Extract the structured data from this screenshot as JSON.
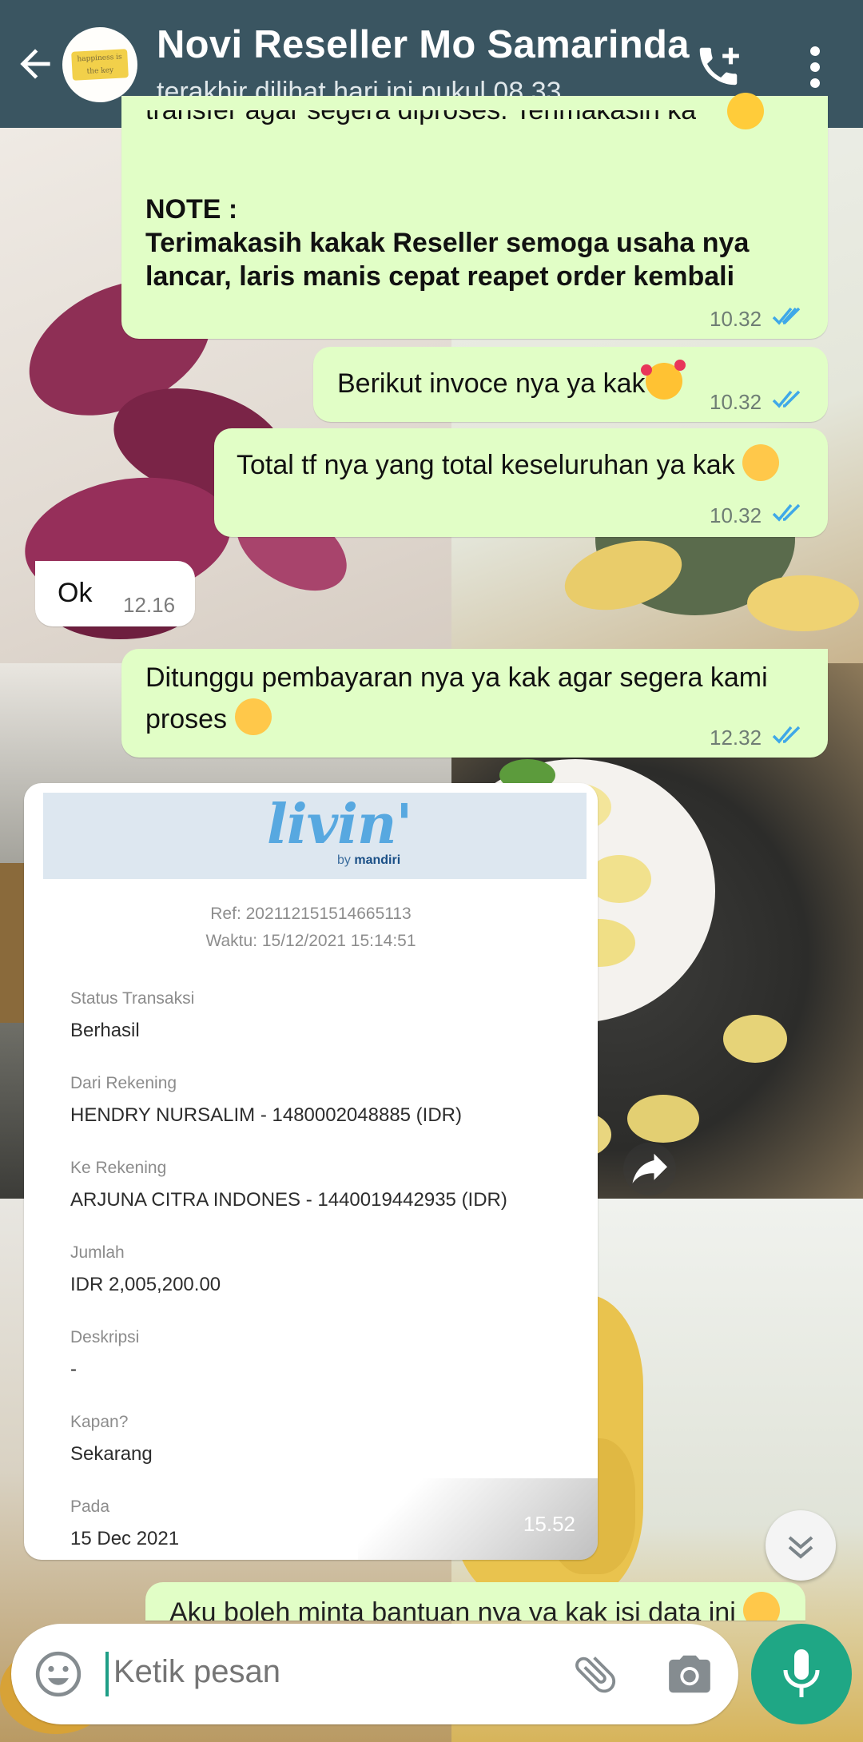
{
  "header": {
    "title": "Novi Reseller Mo Samarinda",
    "status": "terakhir dilihat hari ini pukul 08.33",
    "avatar_text": "happiness is the key"
  },
  "messages": [
    {
      "direction": "outgoing",
      "partial_line": "transfer agar segera diproses. Terimakasih ka",
      "note_label": "NOTE :",
      "note_lines": [
        "Terimakasih kakak Reseller semoga usaha nya",
        "lancar, laris manis cepat reapet order kembali"
      ],
      "time": "10.32"
    },
    {
      "direction": "outgoing",
      "text": "Berikut invoce nya ya kak",
      "emoji": "smiling-face-with-hearts",
      "time": "10.32"
    },
    {
      "direction": "outgoing",
      "text": "Total tf nya yang total keseluruhan ya kak",
      "emoji": "smiling-face",
      "time": "10.32"
    },
    {
      "direction": "incoming",
      "text": "Ok",
      "time": "12.16"
    },
    {
      "direction": "outgoing",
      "lines": [
        "Ditunggu pembayaran nya ya kak agar segera kami",
        "proses"
      ],
      "emoji": "smiling-face",
      "time": "12.32"
    },
    {
      "direction": "outgoing",
      "partial_line": "Aku boleh minta bantuan nya ya kak isi data ini",
      "emoji": "smiling-face"
    }
  ],
  "receipt": {
    "brand": "livin'",
    "brand_by": "by",
    "brand_bank": "mandiri",
    "ref": "Ref: 202112151514665113",
    "waktu": "Waktu: 15/12/2021 15:14:51",
    "fields": [
      {
        "label": "Status Transaksi",
        "value": "Berhasil"
      },
      {
        "label": "Dari Rekening",
        "value": "HENDRY NURSALIM - 1480002048885 (IDR)"
      },
      {
        "label": "Ke Rekening",
        "value": "ARJUNA CITRA INDONES - 1440019442935 (IDR)"
      },
      {
        "label": "Jumlah",
        "value": "IDR 2,005,200.00"
      },
      {
        "label": "Deskripsi",
        "value": "-"
      },
      {
        "label": "Kapan?",
        "value": "Sekarang"
      },
      {
        "label": "Pada",
        "value": "15 Dec 2021"
      }
    ],
    "time": "15.52"
  },
  "input": {
    "placeholder": "Ketik pesan"
  },
  "colors": {
    "header": "#3a5561",
    "outgoing_bubble": "#e1fec6",
    "incoming_bubble": "#ffffff",
    "read_ticks": "#3fa8e8",
    "accent": "#1fa785"
  },
  "icons": [
    "back-arrow-icon",
    "add-call-icon",
    "more-vert-icon",
    "read-ticks-icon",
    "forward-icon",
    "scroll-down-icon",
    "emoji-icon",
    "attach-icon",
    "camera-icon",
    "mic-icon"
  ]
}
